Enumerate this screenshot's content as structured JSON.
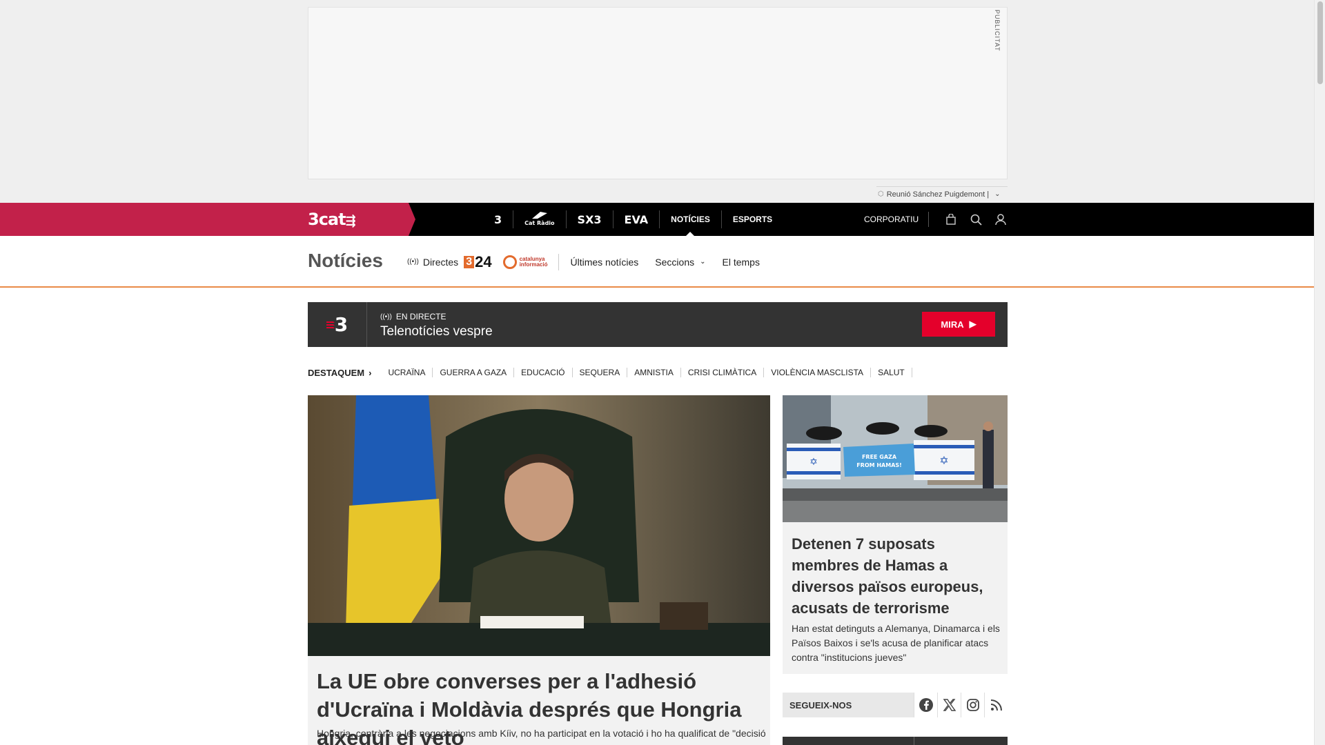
{
  "ad": {
    "label": "PUBLICITAT"
  },
  "trend": {
    "text": "Reunió Sánchez Puigdemont |"
  },
  "topnav": {
    "brand": "3cat",
    "channels": [
      "3",
      "Cat Ràdio",
      "SX3",
      "EVA"
    ],
    "sections": [
      "NOTÍCIES",
      "ESPORTS"
    ],
    "corporate": "CORPORATIU"
  },
  "section_nav": {
    "title": "Notícies",
    "directes": "Directes",
    "channel_324": "24",
    "channel_324_prefix": "3",
    "catinfo": [
      "catalunya",
      "informació"
    ],
    "links": [
      "Últimes notícies",
      "Seccions",
      "El temps"
    ]
  },
  "live": {
    "channel": "3",
    "tag": "EN DIRECTE",
    "title": "Telenotícies vespre",
    "button": "MIRA"
  },
  "destaquem": {
    "label": "DESTAQUEM",
    "tags": [
      "UCRAÏNA",
      "GUERRA A GAZA",
      "EDUCACIÓ",
      "SEQUERA",
      "AMNISTIA",
      "CRISI CLIMÀTICA",
      "VIOLÈNCIA MASCLISTA",
      "SALUT"
    ]
  },
  "main_article": {
    "title": "La UE obre converses per a l'adhesió d'Ucraïna i Moldàvia després que Hongria aixequi el veto",
    "subtitle": "Hongria, contrària a les negociacions amb Kíiv, no ha participat en la votació i ho ha qualificat de \"decisió"
  },
  "side_article": {
    "title": "Detenen 7 suposats membres de Hamas a diversos països europeus, acusats de terrorisme",
    "subtitle": "Han estat detinguts a Alemanya, Dinamarca i els Països Baixos i se'ls acusa de planificar atacs contra \"institucions jueves\"",
    "banner_text": "FREE GAZA FROM HAMAS!"
  },
  "follow": {
    "label": "SEGUEIX-NOS",
    "networks": [
      "facebook-icon",
      "x-icon",
      "instagram-icon",
      "rss-icon"
    ]
  },
  "colors": {
    "brand": "#c2214a",
    "accent": "#e4002b",
    "live_bg": "#333333",
    "section_line": "#e98a46"
  }
}
